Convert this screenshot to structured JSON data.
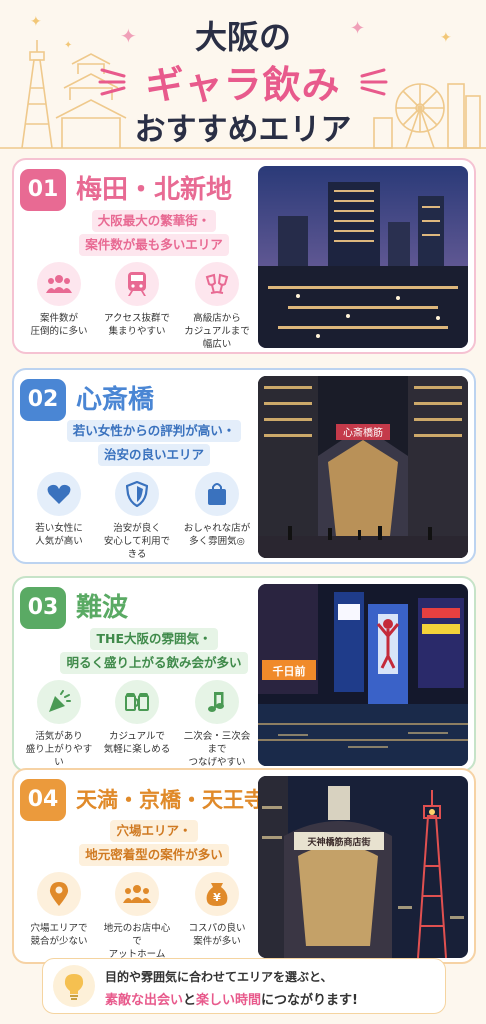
{
  "header": {
    "line1": "大阪の",
    "line2": "ギャラ飲み",
    "line3": "おすすめエリア"
  },
  "areas": [
    {
      "num": "01",
      "title": "梅田・北新地",
      "subtitle_1": "大阪最大の繁華街・",
      "subtitle_2": "案件数が最も多いエリア",
      "accent": "#e86a93",
      "features": [
        {
          "icon": "people-icon",
          "l1": "案件数が",
          "l2": "圧倒的に多い",
          "l3": ""
        },
        {
          "icon": "train-icon",
          "l1": "アクセス抜群で",
          "l2": "集まりやすい",
          "l3": ""
        },
        {
          "icon": "cheers-glass-icon",
          "l1": "高級店から",
          "l2": "カジュアルまで",
          "l3": "幅広い"
        }
      ]
    },
    {
      "num": "02",
      "title": "心斎橋",
      "subtitle_1": "若い女性からの評判が高い・",
      "subtitle_2": "治安の良いエリア",
      "accent": "#4a86d4",
      "features": [
        {
          "icon": "heart-icon",
          "l1": "若い女性に",
          "l2": "人気が高い",
          "l3": ""
        },
        {
          "icon": "shield-icon",
          "l1": "治安が良く",
          "l2": "安心して利用できる",
          "l3": ""
        },
        {
          "icon": "shopping-bag-icon",
          "l1": "おしゃれな店が",
          "l2": "多く雰囲気◎",
          "l3": ""
        }
      ],
      "sign": "心斎橋筋"
    },
    {
      "num": "03",
      "title": "難波",
      "subtitle_1": "THE大阪の雰囲気・",
      "subtitle_2": "明るく盛り上がる飲み会が多い",
      "accent": "#5aaa64",
      "features": [
        {
          "icon": "party-popper-icon",
          "l1": "活気があり",
          "l2": "盛り上がりやすい",
          "l3": ""
        },
        {
          "icon": "beer-mugs-icon",
          "l1": "カジュアルで",
          "l2": "気軽に楽しめる",
          "l3": ""
        },
        {
          "icon": "music-note-icon",
          "l1": "二次会・三次会まで",
          "l2": "つなげやすい",
          "l3": ""
        }
      ],
      "sign": "千日前"
    },
    {
      "num": "04",
      "title": "天満・京橋・天王寺",
      "subtitle_1": "穴場エリア・",
      "subtitle_2": "地元密着型の案件が多い",
      "accent": "#eb9a3c",
      "features": [
        {
          "icon": "map-pin-icon",
          "l1": "穴場エリアで",
          "l2": "競合が少ない",
          "l3": ""
        },
        {
          "icon": "group-icon",
          "l1": "地元のお店中心で",
          "l2": "アットホーム",
          "l3": ""
        },
        {
          "icon": "money-bag-icon",
          "l1": "コスパの良い",
          "l2": "案件が多い",
          "l3": ""
        }
      ],
      "sign": "天神橋筋商店街"
    }
  ],
  "footer": {
    "line1": "目的や雰囲気に合わせてエリアを選ぶと、",
    "hl1": "素敵な出会い",
    "mid": "と",
    "hl2": "楽しい時間",
    "tail": "につながります!"
  },
  "colors": {
    "pink": "#e85a8c",
    "navy": "#2a2f45",
    "gold": "#f2c777"
  }
}
